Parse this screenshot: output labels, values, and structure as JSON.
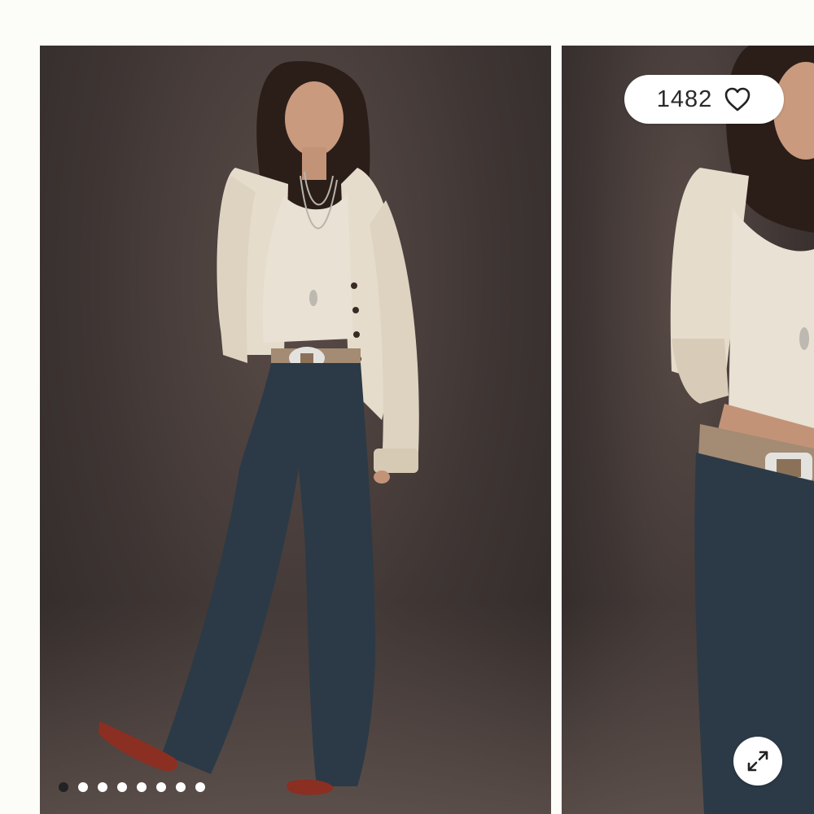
{
  "gallery": {
    "images": [
      {
        "name": "model-full-length-photo",
        "slide": 1
      },
      {
        "name": "model-closeup-photo",
        "slide": 2
      }
    ],
    "likes": {
      "count": "1482",
      "icon": "heart-icon"
    },
    "expand": {
      "icon": "expand-icon"
    },
    "pagination": {
      "total": 8,
      "active": 1
    }
  },
  "colors": {
    "backdrop": "#3f3634",
    "cardigan": "#e6dccb",
    "camisole": "#e9e1d3",
    "pants": "#2b3a46",
    "boots": "#8a2f22",
    "belt": "#a48b74",
    "active_dot": "#222222",
    "inactive_dot": "#ffffff"
  }
}
